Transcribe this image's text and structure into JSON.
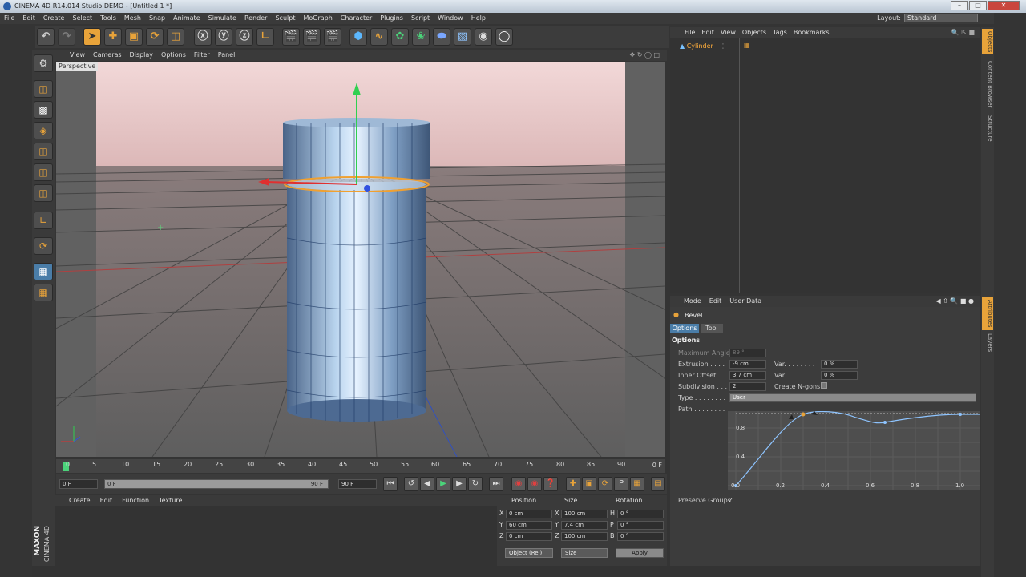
{
  "window": {
    "title": "CINEMA 4D R14.014 Studio DEMO - [Untitled 1 *]",
    "buttons": [
      "–",
      "□",
      "✕"
    ]
  },
  "menubar": {
    "items": [
      "File",
      "Edit",
      "Create",
      "Select",
      "Tools",
      "Mesh",
      "Snap",
      "Animate",
      "Simulate",
      "Render",
      "Sculpt",
      "MoGraph",
      "Character",
      "Plugins",
      "Script",
      "Window",
      "Help"
    ],
    "layout_label": "Layout:",
    "layout_value": "Standard"
  },
  "viewport": {
    "menu": [
      "View",
      "Cameras",
      "Display",
      "Options",
      "Filter",
      "Panel"
    ],
    "label": "Perspective"
  },
  "timeline": {
    "ticks": [
      "0",
      "5",
      "10",
      "15",
      "20",
      "25",
      "30",
      "35",
      "40",
      "45",
      "50",
      "55",
      "60",
      "65",
      "70",
      "75",
      "80",
      "85",
      "90"
    ],
    "current_frame": "0 F"
  },
  "playback": {
    "start_field": "0 F",
    "slider_start": "0 F",
    "slider_end": "90 F",
    "end_field": "90 F"
  },
  "material_manager": {
    "menu": [
      "Create",
      "Edit",
      "Function",
      "Texture"
    ]
  },
  "coordinates": {
    "headers": [
      "Position",
      "Size",
      "Rotation"
    ],
    "rows": [
      {
        "pos_axis": "X",
        "pos": "0 cm",
        "size_axis": "X",
        "size": "100 cm",
        "rot_axis": "H",
        "rot": "0 °"
      },
      {
        "pos_axis": "Y",
        "pos": "60 cm",
        "size_axis": "Y",
        "size": "7.4 cm",
        "rot_axis": "P",
        "rot": "0 °"
      },
      {
        "pos_axis": "Z",
        "pos": "0 cm",
        "size_axis": "Z",
        "size": "100 cm",
        "rot_axis": "B",
        "rot": "0 °"
      }
    ],
    "mode_dropdown": "Object (Rel)",
    "size_dropdown": "Size",
    "apply_label": "Apply"
  },
  "object_manager": {
    "menu": [
      "File",
      "Edit",
      "View",
      "Objects",
      "Tags",
      "Bookmarks"
    ],
    "objects": [
      {
        "name": "Cylinder"
      }
    ]
  },
  "side_tabs": [
    "Objects",
    "Content Browser",
    "Structure",
    "Attributes",
    "Layers"
  ],
  "attribute_manager": {
    "menu": [
      "Mode",
      "Edit",
      "User Data"
    ],
    "tool_name": "Bevel",
    "tabs": [
      "Options",
      "Tool"
    ],
    "section": "Options",
    "fields": {
      "max_angle_label": "Maximum Angle",
      "max_angle_value": "89 °",
      "extrusion_label": "Extrusion . . . .",
      "extrusion_value": "-9 cm",
      "extrusion_var_label": "Var. . . . . . . .",
      "extrusion_var_value": "0 %",
      "inner_offset_label": "Inner Offset . .",
      "inner_offset_value": "3.7 cm",
      "inner_var_label": "Var. . . . . . . .",
      "inner_var_value": "0 %",
      "subdivision_label": "Subdivision . . .",
      "subdivision_value": "2",
      "create_ngons_label": "Create N-gons",
      "type_label": "Type . . . . . . . .",
      "type_value": "User",
      "path_label": "Path . . . . . . . .",
      "preserve_groups_label": "Preserve Groups",
      "preserve_groups_check": "✓"
    },
    "curve": {
      "y_ticks": [
        "0.8",
        "0.4"
      ],
      "x_ticks": [
        "0.0",
        "0.2",
        "0.4",
        "0.6",
        "0.8",
        "1.0"
      ]
    }
  },
  "branding": {
    "maxon": "MAXON",
    "cinema": "CINEMA 4D"
  }
}
